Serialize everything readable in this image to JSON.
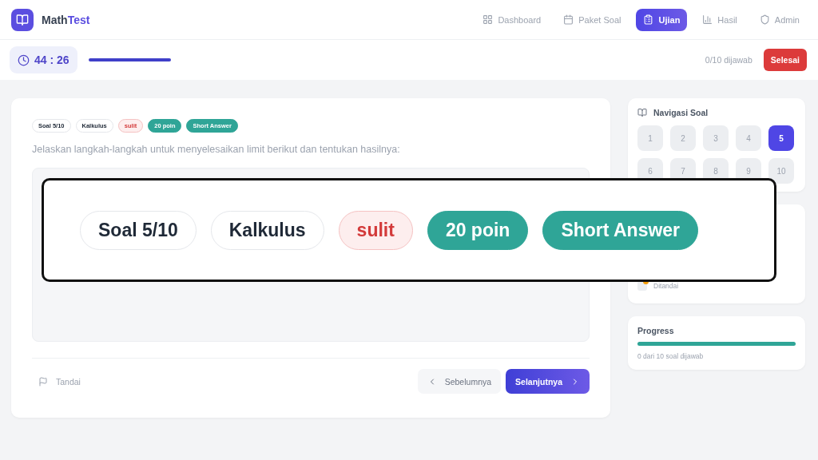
{
  "app": {
    "logo_first": "Math",
    "logo_second": "Test"
  },
  "nav": [
    {
      "label": "Dashboard",
      "selected": false
    },
    {
      "label": "Paket Soal",
      "selected": false
    },
    {
      "label": "Ujian",
      "selected": true
    },
    {
      "label": "Hasil",
      "selected": false
    },
    {
      "label": "Admin",
      "selected": false
    }
  ],
  "exam_bar": {
    "time": "44 : 26",
    "answered": "0/10 dijawab",
    "finish": "Selesai"
  },
  "question": {
    "tags": [
      {
        "text": "Soal 5/10",
        "kind": "outline"
      },
      {
        "text": "Kalkulus",
        "kind": "outline"
      },
      {
        "text": "sulit",
        "kind": "danger"
      },
      {
        "text": "20 poin",
        "kind": "teal"
      },
      {
        "text": "Short Answer",
        "kind": "teal"
      }
    ],
    "text": "Jelaskan langkah-langkah untuk menyelesaikan limit berikut dan tentukan hasilnya:",
    "flag": "Tandai",
    "prev": "Sebelumnya",
    "next": "Selanjutnya"
  },
  "navigator": {
    "title": "Navigasi Soal",
    "numbers": [
      {
        "label": "1",
        "selected": false
      },
      {
        "label": "2",
        "selected": false
      },
      {
        "label": "3",
        "selected": false
      },
      {
        "label": "4",
        "selected": false
      },
      {
        "label": "5",
        "selected": true
      },
      {
        "label": "6",
        "selected": false
      },
      {
        "label": "7",
        "selected": false
      },
      {
        "label": "8",
        "selected": false
      },
      {
        "label": "9",
        "selected": false
      },
      {
        "label": "10",
        "selected": false
      }
    ]
  },
  "legend": [
    {
      "label": "Ditandai",
      "color": "#f59e0b"
    }
  ],
  "progress": {
    "title": "Progress",
    "caption": "0 dari 10 soal dijawab"
  },
  "callout": {
    "tags": [
      {
        "text": "Soal 5/10",
        "kind": "outline"
      },
      {
        "text": "Kalkulus",
        "kind": "outline"
      },
      {
        "text": "sulit",
        "kind": "danger"
      },
      {
        "text": "20 poin",
        "kind": "teal"
      },
      {
        "text": "Short Answer",
        "kind": "teal"
      }
    ]
  }
}
